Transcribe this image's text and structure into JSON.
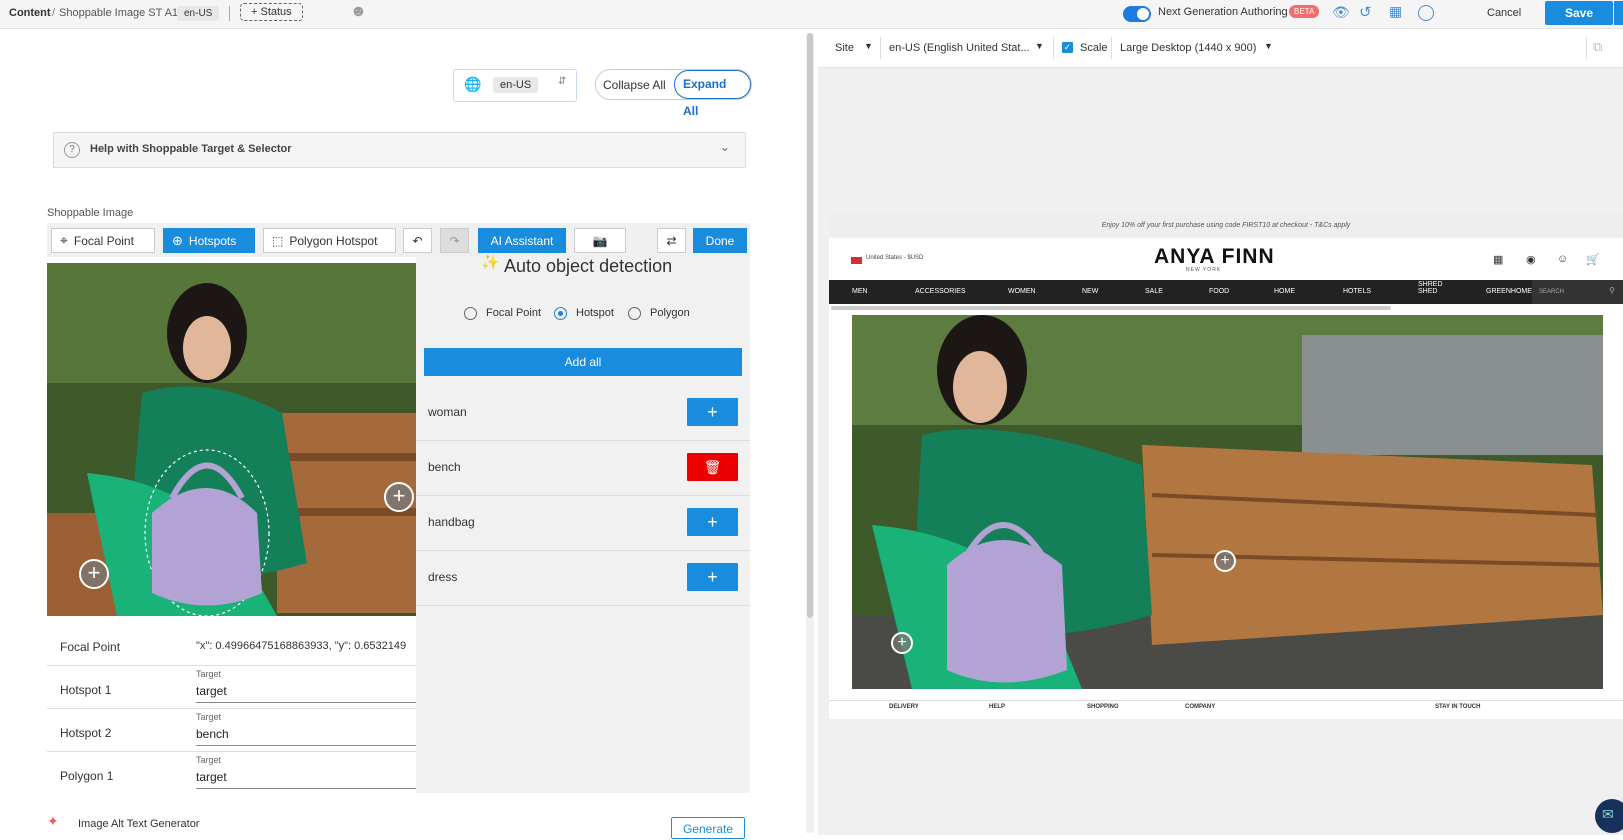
{
  "topbar": {
    "breadcrumb_root": "Content",
    "breadcrumb_sep": "/",
    "breadcrumb_item": "Shoppable Image ST A1",
    "locale_chip": "en-US",
    "status_button": "+ Status",
    "nga_label": "Next Generation Authoring",
    "beta_badge": "BETA",
    "cancel_label": "Cancel",
    "save_label": "Save"
  },
  "editor": {
    "locale_value": "en-US",
    "collapse_all": "Collapse All",
    "expand_all": "Expand All",
    "help_title": "Help with Shoppable Target & Selector",
    "section_title": "Shoppable Image",
    "toolbar": {
      "focal_point": "Focal Point",
      "hotspots": "Hotspots",
      "polygon_hotspot": "Polygon Hotspot",
      "ai_assistant": "AI Assistant",
      "done": "Done"
    },
    "rows": [
      {
        "label": "Focal Point",
        "value": "\"x\": 0.49966475168863933, \"y\": 0.6532149"
      },
      {
        "label": "Hotspot 1",
        "target_label": "Target",
        "value": "target"
      },
      {
        "label": "Hotspot 2",
        "target_label": "Target",
        "value": "bench"
      },
      {
        "label": "Polygon 1",
        "target_label": "Target",
        "value": "target"
      }
    ],
    "alt_text_label": "Image Alt Text Generator",
    "generate": "Generate"
  },
  "auto_detect": {
    "title": "Auto object detection",
    "modes": [
      "Focal Point",
      "Hotspot",
      "Polygon"
    ],
    "selected_mode": "Hotspot",
    "add_all": "Add all",
    "items": [
      {
        "label": "woman",
        "action": "add"
      },
      {
        "label": "bench",
        "action": "delete"
      },
      {
        "label": "handbag",
        "action": "add"
      },
      {
        "label": "dress",
        "action": "add"
      }
    ]
  },
  "preview": {
    "site": "Site",
    "locale": "en-US (English United Stat...",
    "scale_label": "Scale",
    "device": "Large Desktop (1440 x 900)",
    "promo": "Enjoy 10% off your first purchase using code FIRST10 at checkout - T&Cs apply",
    "region": "United States - $USD",
    "brand": "ANYA FINN",
    "brand_sub": "NEW YORK",
    "nav": [
      "MEN",
      "ACCESSORIES",
      "WOMEN",
      "NEW",
      "SALE",
      "FOOD",
      "HOME",
      "HOTELS",
      "SHRED SHED",
      "GREENHOME"
    ],
    "search_placeholder": "SEARCH",
    "footer": [
      "DELIVERY",
      "HELP",
      "SHOPPING",
      "COMPANY",
      "STAY IN TOUCH"
    ]
  },
  "colors": {
    "accent": "#1a8cde",
    "delete": "#e00000",
    "beta": "#f26d6d"
  }
}
